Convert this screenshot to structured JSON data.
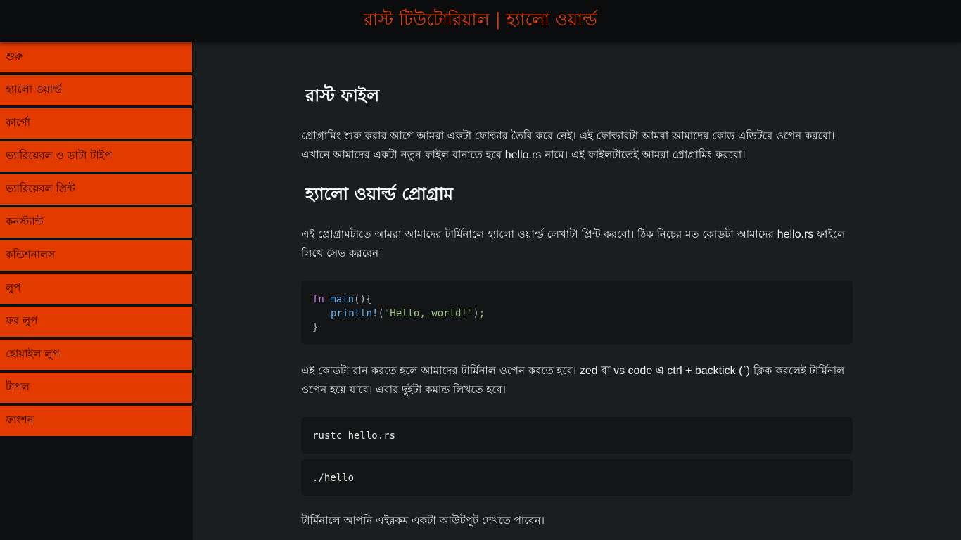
{
  "header": {
    "title": "রাস্ট টিউটোরিয়াল | হ্যালো ওয়ার্ল্ড"
  },
  "sidebar": {
    "items": [
      {
        "label": "শুরু"
      },
      {
        "label": "হ্যালো ওয়ার্ল্ড"
      },
      {
        "label": "কার্গো"
      },
      {
        "label": "ভ্যারিয়েবল ও ডাটা টাইপ"
      },
      {
        "label": "ভ্যারিয়েবল প্রিন্ট"
      },
      {
        "label": "কনস্ট্যান্ট"
      },
      {
        "label": "কন্ডিশনালস"
      },
      {
        "label": "লুপ"
      },
      {
        "label": "ফর লুপ"
      },
      {
        "label": "হোয়াইল লুপ"
      },
      {
        "label": "টাপল"
      },
      {
        "label": "ফাংশন"
      }
    ]
  },
  "main": {
    "heading_rust_file": "রাস্ট ফাইল",
    "p1_part1": "প্রোগ্রামিং শুরু করার আগে আমরা একটা ফোল্ডার তৈরি করে নেই। এই ফোল্ডারটা আমরা আমাদের কোড এডিটরে ওপেন করবো। এখানে আমাদের একটা নতুন ফাইল বানাতে হবে ",
    "p1_code": "hello.rs",
    "p1_part2": " নামে। এই ফাইলটাতেই আমরা প্রোগ্রামিং করবো।",
    "heading_hello_program": "হ্যালো ওয়ার্ল্ড প্রোগ্রাম",
    "p2_part1": "এই প্রোগ্রামটাতে আমরা আমাদের টার্মিনালে হ্যালো ওয়ার্ল্ড লেখাটা প্রিন্ট করবো। ঠিক নিচের মত কোডটা আমাদের ",
    "p2_code": "hello.rs",
    "p2_part2": " ফাইলে লিখে সেভ করবেন।",
    "code_main": {
      "kw_fn": "fn",
      "fn_name": "main",
      "open": "(){",
      "macro": "println!",
      "paren_open": "(",
      "string": "\"Hello, world!\"",
      "paren_close": ")",
      "semicolon": ";",
      "close": "}"
    },
    "p3_part1": "এই কোডটা রান করতে হলে আমাদের টার্মিনাল ওপেন করতে হবে। ",
    "p3_code": "zed বা vs code এ ctrl + backtick (`)",
    "p3_part2": " ক্লিক করলেই টার্মিনাল ওপেন হয়ে যাবে। এবার দুইটা কমান্ড লিখতে হবে।",
    "code_rustc": "rustc hello.rs",
    "code_run": "./hello",
    "p4": "টার্মিনালে আপনি এইরকম একটা আউটপুট দেখতে পাবেন।"
  },
  "colors": {
    "accent": "#e33a00",
    "title": "#e63b00",
    "background": "#1b1e21",
    "topbar": "#0b0c0d",
    "code_bg": "#141516"
  }
}
